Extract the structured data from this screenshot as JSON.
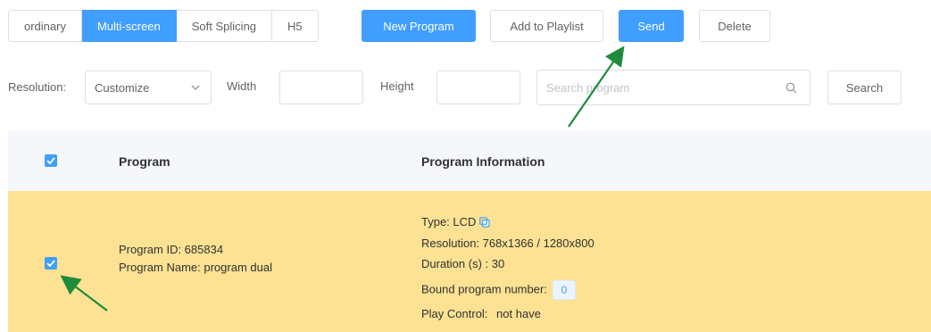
{
  "tabs": [
    {
      "label": "ordinary",
      "active": false
    },
    {
      "label": "Multi-screen",
      "active": true
    },
    {
      "label": "Soft Splicing",
      "active": false
    },
    {
      "label": "H5",
      "active": false
    }
  ],
  "toolbar": {
    "new_program": "New Program",
    "add_to_playlist": "Add to Playlist",
    "send": "Send",
    "delete": "Delete"
  },
  "filters": {
    "resolution_label": "Resolution:",
    "resolution_value": "Customize",
    "width_label": "Width",
    "width_value": "",
    "height_label": "Height",
    "height_value": "",
    "search_placeholder": "Search program",
    "search_button": "Search"
  },
  "table": {
    "headers": {
      "program": "Program",
      "info": "Program Information"
    },
    "header_checked": true,
    "rows": [
      {
        "checked": true,
        "program_id": "Program ID: 685834",
        "program_name": "Program Name: program dual",
        "type": "Type: LCD",
        "resolution": "Resolution: 768x1366 / 1280x800",
        "duration": "Duration (s) : 30",
        "bound_label": "Bound program number:",
        "bound_value": "0",
        "play_control_label": "Play Control:",
        "play_control_value": "not have"
      }
    ]
  },
  "colors": {
    "primary": "#409eff",
    "selected_row": "#fde293",
    "header_bg": "#f5f7fa",
    "annotation_arrow": "#1e8c3a"
  },
  "icons": [
    "chevron-down-icon",
    "search-icon",
    "copy-icon",
    "check-icon"
  ]
}
